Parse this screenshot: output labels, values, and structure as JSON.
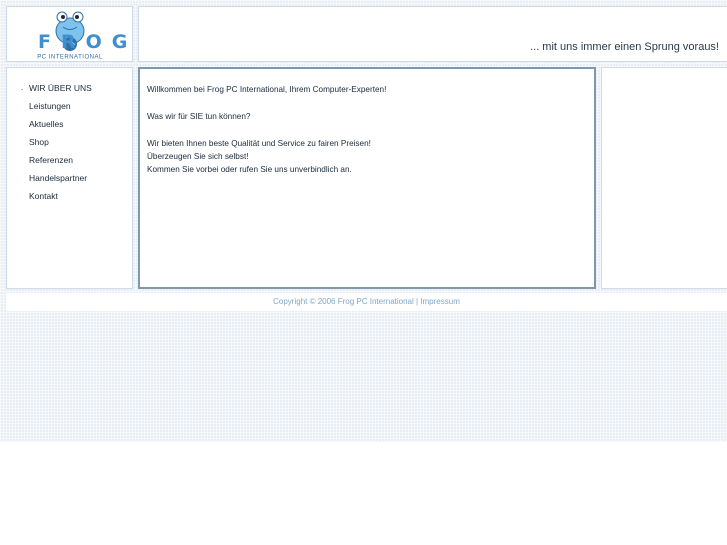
{
  "header": {
    "logo": {
      "word": "FROG",
      "subtitle": "PC INTERNATIONAL"
    },
    "tagline": "... mit uns immer einen Sprung voraus!"
  },
  "nav": {
    "items": [
      {
        "label": "WIR ÜBER UNS",
        "active": true
      },
      {
        "label": "Leistungen"
      },
      {
        "label": "Aktuelles"
      },
      {
        "label": "Shop"
      },
      {
        "label": "Referenzen"
      },
      {
        "label": "Handelspartner"
      },
      {
        "label": "Kontakt"
      }
    ],
    "active_marker": "."
  },
  "content": {
    "welcome": "Willkommen bei Frog PC International, Ihrem Computer-Experten!",
    "question": "Was wir für SIE tun können?",
    "line1": "Wir bieten Ihnen beste Qualität und Service zu fairen Preisen!",
    "line2": "Überzeugen Sie sich selbst!",
    "line3": "Kommen Sie vorbei oder rufen Sie uns unverbindlich an."
  },
  "footer": {
    "copyright": "Copyright © 2006 Frog PC International",
    "separator": " | ",
    "impressum": "Impressum"
  },
  "colors": {
    "background": "#e8eef3",
    "panel_border": "#cfdbe6",
    "content_border": "#7f99aa",
    "text": "#1b2a3a",
    "footer_link": "#7fa7c8",
    "logo_blue": "#3f8fd0"
  }
}
